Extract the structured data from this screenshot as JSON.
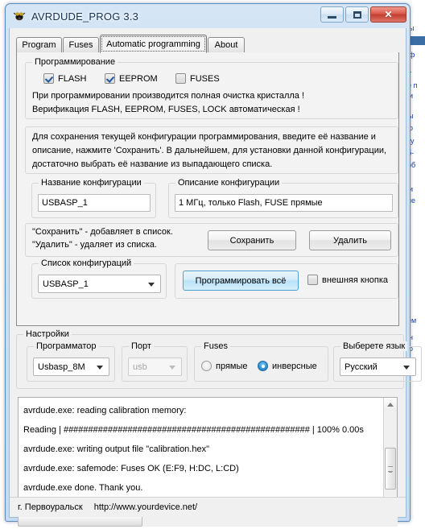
{
  "window": {
    "title": "AVRDUDE_PROG 3.3",
    "icon": "bug-icon",
    "buttons": {
      "minimize": "minimize-icon",
      "maximize": "maximize-icon",
      "close": "close-icon"
    },
    "colors": {
      "accent": "#b9e1f8",
      "close_red": "#c23e2f",
      "check_blue": "#21569e",
      "frame_blue": "#5a8bbd"
    }
  },
  "tabs": [
    {
      "label": "Program",
      "active": false
    },
    {
      "label": "Fuses",
      "active": false
    },
    {
      "label": "Automatic programming",
      "active": true
    },
    {
      "label": "About",
      "active": false
    }
  ],
  "programming_group": {
    "legend": "Программирование",
    "checkboxes": [
      {
        "label": "FLASH",
        "checked": true
      },
      {
        "label": "EEPROM",
        "checked": true
      },
      {
        "label": "FUSES",
        "checked": false
      }
    ],
    "note1": "При программировании производится полная очистка кристалла !",
    "note2": "Верификация FLASH, EEPROM, FUSES, LOCK автоматическая !"
  },
  "config_info": {
    "line1": "Для сохранения текущей конфигурации программирования, введите её название и",
    "line2": "описание, нажмите 'Сохранить'. В дальнейшем, для установки данной конфигурации,",
    "line3": "достаточно выбрать её название из выпадающего списка."
  },
  "config_name": {
    "legend": "Название конфигурации",
    "value": "USBASP_1",
    "placeholder": ""
  },
  "config_desc": {
    "legend": "Описание конфигурации",
    "value": "1 МГц, только Flash, FUSE прямые",
    "placeholder": ""
  },
  "save_hint": {
    "line1": "\"Сохранить\" - добавляет в список.",
    "line2": "\"Удалить\" - удаляет из списка."
  },
  "save_button": "Сохранить",
  "delete_button": "Удалить",
  "config_list": {
    "legend": "Список конфигураций",
    "value": "USBASP_1"
  },
  "program_all_button": "Программировать всё",
  "external_button_checkbox": {
    "label": "внешняя кнопка",
    "checked": false
  },
  "settings": {
    "legend": "Настройки",
    "programmer": {
      "legend": "Программатор",
      "value": "Usbasp_8M",
      "disabled": false
    },
    "port": {
      "legend": "Порт",
      "value": "usb",
      "disabled": true
    },
    "fuses": {
      "legend": "Fuses",
      "options": [
        {
          "label": "прямые",
          "selected": false
        },
        {
          "label": "инверсные",
          "selected": true
        }
      ]
    },
    "language": {
      "legend": "Выберете язык",
      "value": "Русский",
      "disabled": false
    }
  },
  "log": {
    "lines": [
      "avrdude.exe: reading calibration memory:",
      "Reading | ################################################## | 100% 0.00s",
      "avrdude.exe: writing output file \"calibration.hex\"",
      "avrdude.exe: safemode: Fuses OK (E:F9, H:DC, L:CD)",
      "avrdude.exe done.  Thank you."
    ]
  },
  "statusbar": {
    "city": "г. Первоуральск",
    "url": "http://www.yourdevice.net/"
  },
  "background": {
    "snippets": [
      "ы",
      "ф",
      "т",
      "е п",
      "и",
      "ы",
      "о",
      "ку",
      "б-",
      "об",
      "и",
      "не",
      "ем",
      "н",
      "о"
    ]
  }
}
